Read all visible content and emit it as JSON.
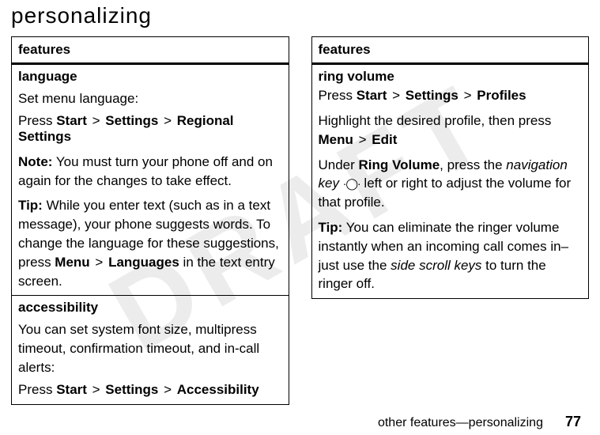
{
  "watermark": "DRAFT",
  "page_title": "personalizing",
  "left": {
    "header": "features",
    "language": {
      "title": "language",
      "intro": "Set menu language:",
      "press": "Press ",
      "p1": "Start",
      "gt": " > ",
      "p2": "Settings",
      "p3": "Regional Settings",
      "note_label": "Note:",
      "note_text": " You must turn your phone off and on again for the changes to take effect.",
      "tip_label": "Tip:",
      "tip_text_a": " While you enter text (such as in a text message), your phone suggests words. To change the language for these suggestions, press ",
      "tip_menu": "Menu",
      "tip_lang": "Languages",
      "tip_text_b": " in the text entry screen."
    },
    "accessibility": {
      "title": "accessibility",
      "text": "You can set system font size, multipress timeout, confirmation timeout, and in-call alerts:",
      "press": "Press ",
      "p1": "Start",
      "p2": "Settings",
      "p3": "Accessibility"
    }
  },
  "right": {
    "header": "features",
    "ring": {
      "title": "ring volume",
      "press": "Press ",
      "p1": "Start",
      "gt": " > ",
      "p2": "Settings",
      "p3": "Profiles",
      "highlight_a": "Highlight the desired profile, then press ",
      "menu": "Menu",
      "edit": "Edit",
      "under_a": "Under ",
      "ringvol": "Ring Volume",
      "under_b": ", press the ",
      "navkey": "navigation key",
      "nav_icon": "·◯·",
      "under_c": " left or right to adjust the volume for that profile.",
      "tip_label": "Tip:",
      "tip_text_a": " You can eliminate the ringer volume instantly when an incoming call comes in–just use the ",
      "side_keys": "side scroll keys",
      "tip_text_b": " to turn the ringer off."
    }
  },
  "footer": {
    "text": "other features—personalizing",
    "page": "77"
  }
}
